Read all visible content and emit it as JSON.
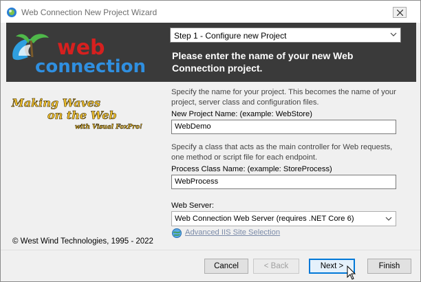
{
  "window": {
    "title": "Web Connection New Project Wizard",
    "icons": {
      "app": "web-connection-app-icon",
      "close": "close-icon"
    }
  },
  "header": {
    "logo_text": [
      "web",
      "connection"
    ],
    "step_select": {
      "value": "Step 1 - Configure new Project",
      "icon": "chevron-down-icon"
    },
    "title": "Please enter the name of your new Web Connection project."
  },
  "sidebar": {
    "slogan": [
      "Making Waves",
      "on the Web",
      "with Visual FoxPro!"
    ],
    "copyright": "© West Wind Technologies, 1995 - 2022"
  },
  "form": {
    "project_desc": "Specify the name for your project. This becomes the name of your project, server class and configuration files.",
    "project_label": "New Project Name:   (example: WebStore)",
    "project_value": "WebDemo",
    "process_desc": "Specify a  class that acts as the  main controller for Web requests, one method or script file for each endpoint.",
    "process_label": "Process Class Name:  (example: StoreProcess)",
    "process_value": "WebProcess",
    "server_label": "Web Server:",
    "server_value": "Connection Web Server (requires .NET Core 6)",
    "server_prefix": "Web",
    "iis_link": "Advanced  IIS Site Selection"
  },
  "buttons": {
    "cancel": "Cancel",
    "back": "< Back",
    "next": "Next >",
    "finish": "Finish"
  },
  "colors": {
    "header_bg": "#3a3a3a",
    "logo_red": "#d6201f",
    "logo_blue": "#1f6fc5",
    "focus_blue": "#0078d7"
  }
}
